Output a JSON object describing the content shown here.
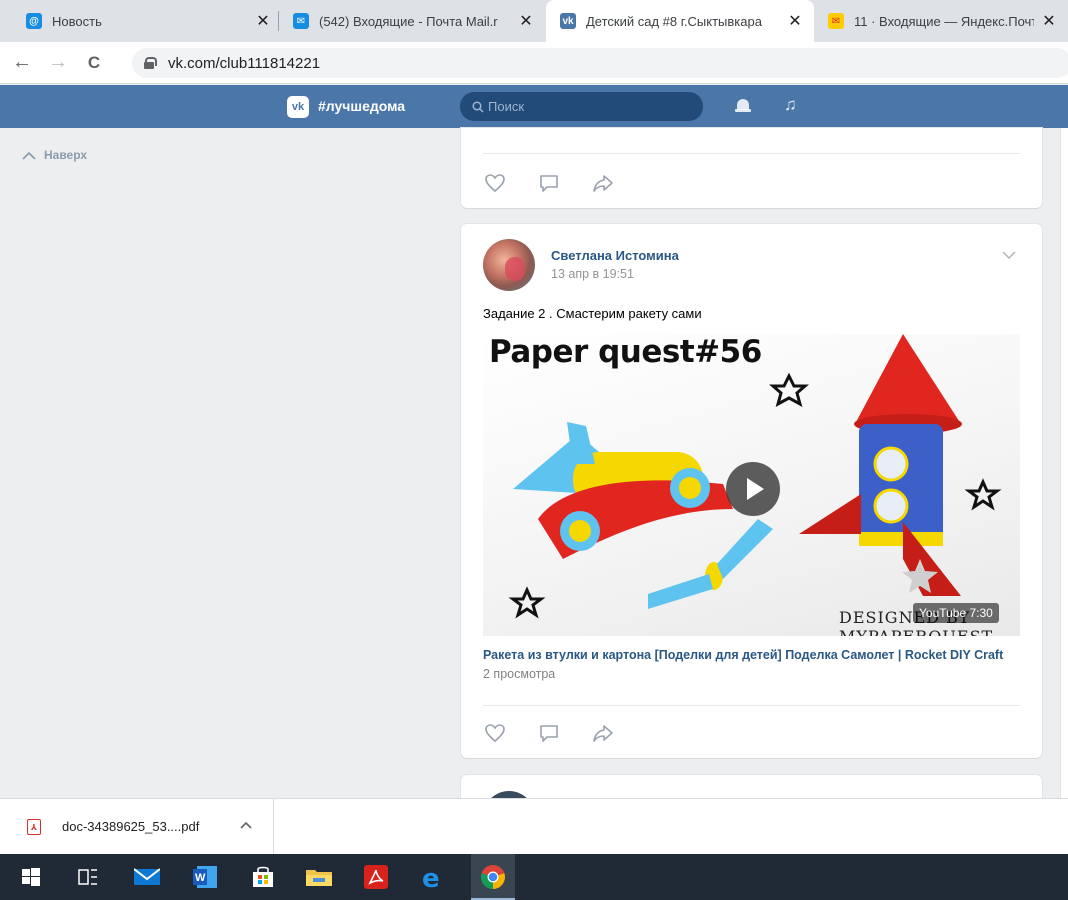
{
  "browser": {
    "tabs": [
      {
        "title": "Новость",
        "favicon_color": "#168de2",
        "favicon_glyph": "@",
        "active": false
      },
      {
        "title": "(542) Входящие - Почта Mail.r",
        "favicon_color": "#168de2",
        "favicon_glyph": "✉",
        "active": false
      },
      {
        "title": "Детский сад #8 г.Сыктывкара",
        "favicon_color": "#4a76a8",
        "favicon_glyph": "vk",
        "active": true
      },
      {
        "title": "11 · Входящие — Яндекс.Почт",
        "favicon_color": "#ffcc00",
        "favicon_glyph": "✉",
        "active": false
      }
    ],
    "tab_close_glyph": "✕",
    "url": "vk.com/club111814221",
    "nav": {
      "back": "←",
      "forward": "→",
      "reload": "C"
    }
  },
  "vk_header": {
    "logo": "vk",
    "brand": "#лучшедома",
    "search_placeholder": "Поиск",
    "accent": "#4a76a8"
  },
  "left": {
    "to_top_label": "Наверх"
  },
  "post": {
    "author": "Светлана Истомина",
    "date": "13 апр в 19:51",
    "text": "Задание 2 . Смастерим ракету сами",
    "video": {
      "overlay_title": "Paper quest#56",
      "designed_by": "DESIGNED BY MYPAPERQUEST",
      "provider": "YouTube",
      "duration": "7:30",
      "link_title": "Ракета из втулки и картона [Поделки для детей] Поделка Самолет | Rocket DIY Craft",
      "views": "2 просмотра"
    }
  },
  "downloads": {
    "file_name": "doc-34389625_53....pdf",
    "file_type": "pdf"
  },
  "taskbar": {
    "items": [
      "windows-start-icon",
      "task-view-icon",
      "mail-icon",
      "word-icon",
      "store-icon",
      "file-explorer-icon",
      "acrobat-icon",
      "edge-icon",
      "chrome-icon"
    ]
  }
}
